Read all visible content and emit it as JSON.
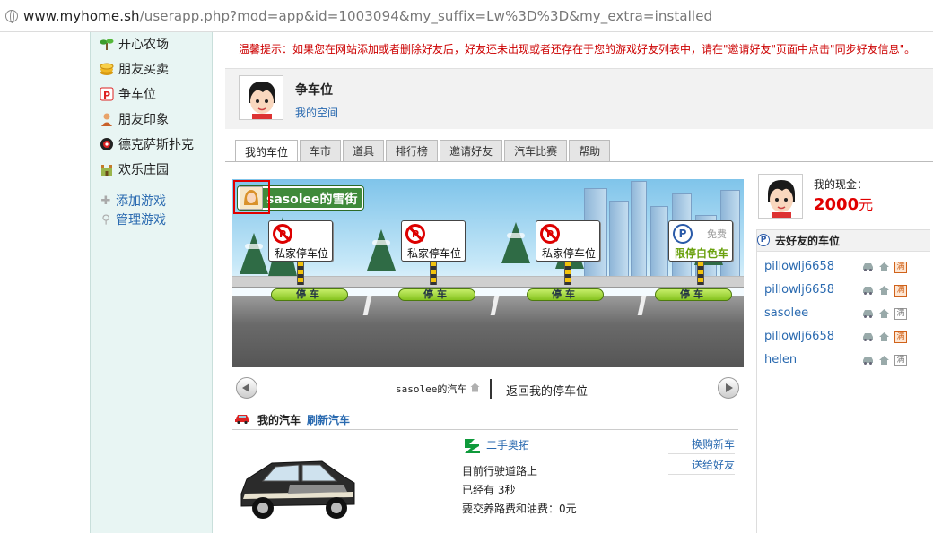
{
  "browser": {
    "url_host": "www.myhome.sh",
    "url_path": "/userapp.php?mod=app&id=1003094&my_suffix=Lw%3D%3D&my_extra=installed"
  },
  "leftnav": {
    "games": [
      {
        "label": "开心农场",
        "icon": "sprout-icon"
      },
      {
        "label": "朋友买卖",
        "icon": "coins-icon"
      },
      {
        "label": "争车位",
        "icon": "parking-icon"
      },
      {
        "label": "朋友印象",
        "icon": "person-icon"
      },
      {
        "label": "德克萨斯扑克",
        "icon": "poker-chip-icon"
      },
      {
        "label": "欢乐庄园",
        "icon": "castle-icon"
      }
    ],
    "links": [
      {
        "label": "添加游戏",
        "icon": "plus-icon"
      },
      {
        "label": "管理游戏",
        "icon": "wrench-icon"
      }
    ]
  },
  "warning": "温馨提示：如果您在网站添加或者删除好友后，好友还未出现或者还存在于您的游戏好友列表中，请在\"邀请好友\"页面中点击\"同步好友信息\"。",
  "app": {
    "title": "争车位",
    "myspace": "我的空间"
  },
  "tabs": [
    "我的车位",
    "车市",
    "道具",
    "排行榜",
    "邀请好友",
    "汽车比赛",
    "帮助"
  ],
  "street": {
    "name": "sasolee的雪街",
    "spots": [
      {
        "label": "私家停车位",
        "type": "private",
        "button": "停车"
      },
      {
        "label": "私家停车位",
        "type": "private",
        "button": "停车"
      },
      {
        "label": "私家停车位",
        "type": "private",
        "button": "停车"
      },
      {
        "label": "限停白色车",
        "type": "free",
        "free_text": "免费",
        "button": "停车"
      }
    ]
  },
  "street_nav": {
    "current": "sasolee的汽车",
    "back": "返回我的停车位"
  },
  "mycar": {
    "title": "我的汽车",
    "refresh": "刷新汽车",
    "brand": "二手奥拓",
    "status": "目前行驶道路上",
    "duration": "已经有 3秒",
    "fee": "要交养路费和油费：0元",
    "actions": [
      "换购新车",
      "送给好友"
    ]
  },
  "wallet": {
    "label": "我的现金：",
    "amount": "2000",
    "unit": "元"
  },
  "friends": {
    "title": "去好友的车位",
    "list": [
      {
        "name": "pillowlj6658",
        "hot": true
      },
      {
        "name": "pillowlj6658",
        "hot": true
      },
      {
        "name": "sasolee",
        "hot": false
      },
      {
        "name": "pillowlj6658",
        "hot": true
      },
      {
        "name": "helen",
        "hot": false
      }
    ],
    "full_glyph": "满"
  },
  "colors": {
    "accent_link": "#2a6ab0",
    "warning_red": "#cc0000",
    "cash_red": "#e00000",
    "sidebar_bg": "#e8f5f3",
    "park_button_green": "#85c31e"
  }
}
